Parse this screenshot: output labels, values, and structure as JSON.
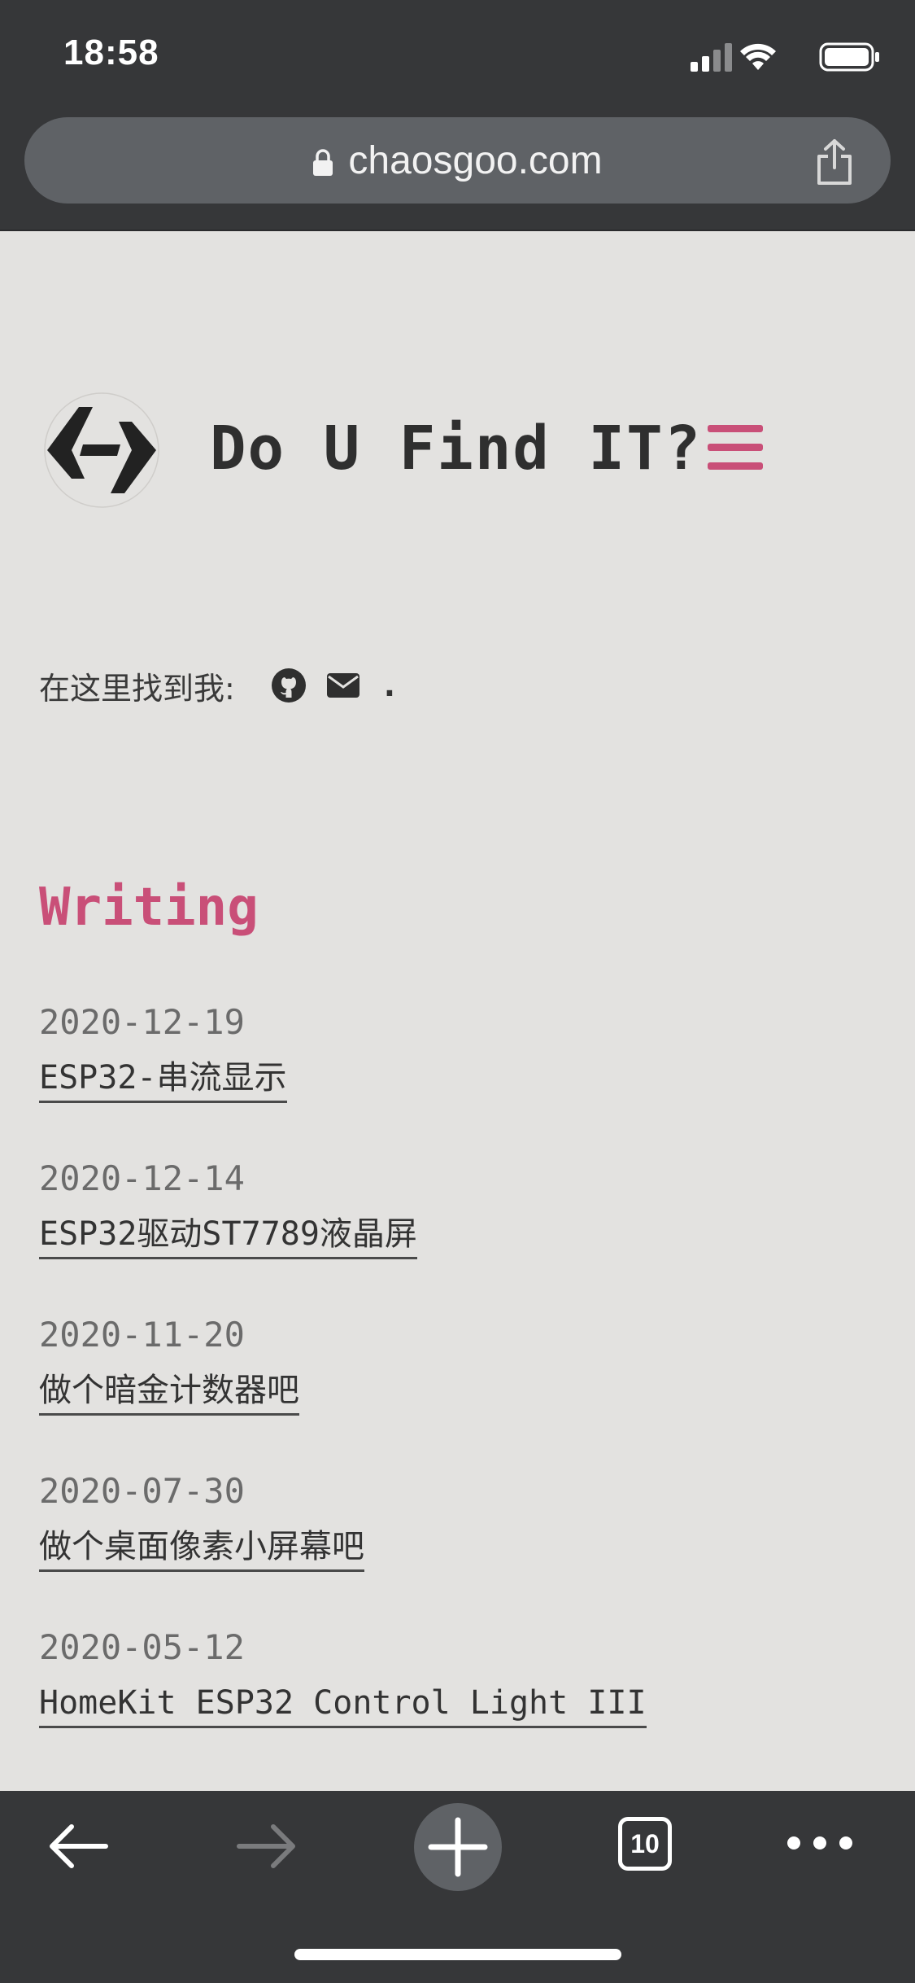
{
  "status_bar": {
    "time": "18:58"
  },
  "browser": {
    "url": "chaosgoo.com",
    "tab_count": "10"
  },
  "site": {
    "title": "Do U Find IT?"
  },
  "find_me": {
    "label": "在这里找到我:",
    "dot": "."
  },
  "writing": {
    "title": "Writing",
    "posts": [
      {
        "date": "2020-12-19",
        "title": "ESP32-串流显示"
      },
      {
        "date": "2020-12-14",
        "title": "ESP32驱动ST7789液晶屏"
      },
      {
        "date": "2020-11-20",
        "title": "做个暗金计数器吧"
      },
      {
        "date": "2020-07-30",
        "title": "做个桌面像素小屏幕吧"
      },
      {
        "date": "2020-05-12",
        "title": "HomeKit ESP32 Control Light III"
      }
    ]
  },
  "colors": {
    "accent": "#c94f78",
    "chrome": "#363739",
    "page_bg": "#e3e2e0"
  }
}
